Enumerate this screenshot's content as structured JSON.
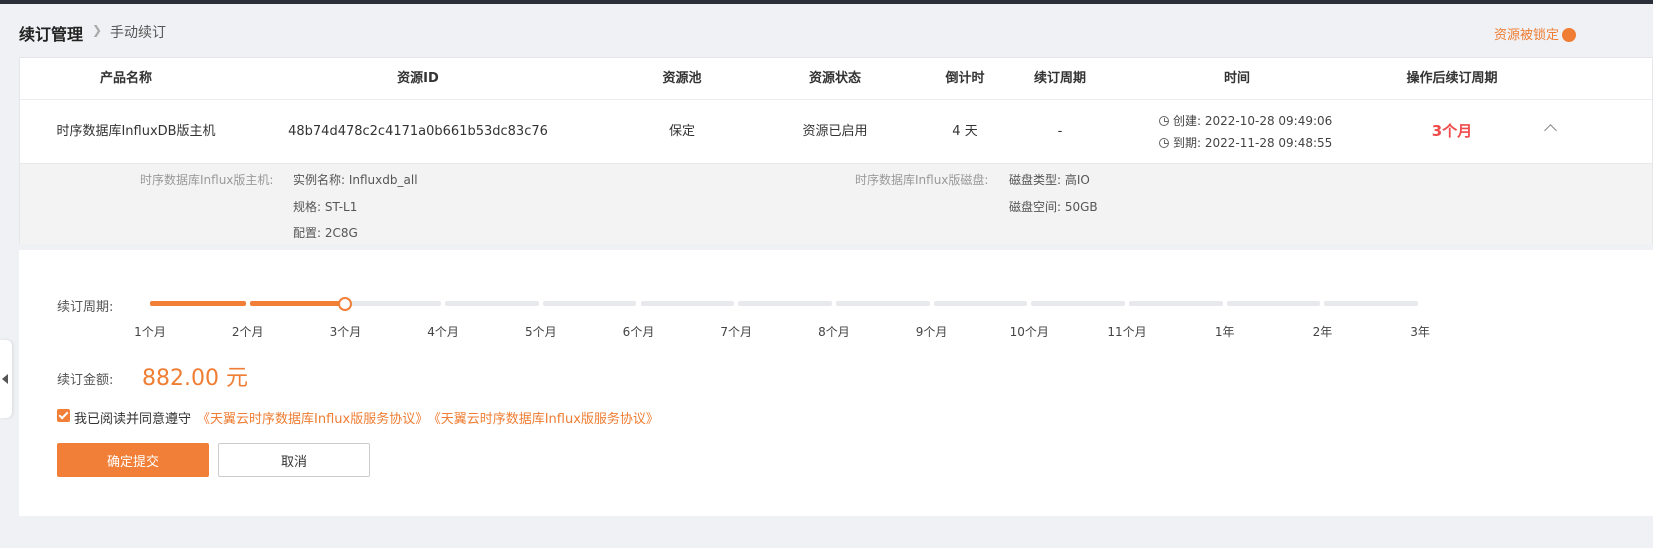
{
  "breadcrumb": {
    "title": "续订管理",
    "current": "手动续订"
  },
  "lock_link": "资源被锁定",
  "table": {
    "headers": [
      "产品名称",
      "资源ID",
      "资源池",
      "资源状态",
      "倒计时",
      "续订周期",
      "时间",
      "操作后续订周期"
    ],
    "row": {
      "product": "时序数据库InfluxDB版主机",
      "resource_id": "48b74d478c2c4171a0b661b53dc83c76",
      "pool": "保定",
      "status": "资源已启用",
      "countdown": "4 天",
      "period": "-",
      "created": "创建: 2022-10-28 09:49:06",
      "expires": "到期: 2022-11-28 09:48:55",
      "new_period": "3个月"
    },
    "detail": {
      "host_label": "时序数据库Influx版主机:",
      "host_fields": [
        "实例名称:  Influxdb_all",
        "规格:  ST-L1",
        "配置:  2C8G"
      ],
      "disk_label": "时序数据库Influx版磁盘:",
      "disk_fields": [
        "磁盘类型:  高IO",
        "磁盘空间:  50GB"
      ]
    }
  },
  "renew": {
    "period_label": "续订周期:",
    "options": [
      "1个月",
      "2个月",
      "3个月",
      "4个月",
      "5个月",
      "6个月",
      "7个月",
      "8个月",
      "9个月",
      "10个月",
      "11个月",
      "1年",
      "2年",
      "3年"
    ],
    "selected_index": 2,
    "amount_label": "续订金额:",
    "amount": "882.00 元",
    "agree_text": "我已阅读并同意遵守",
    "agreements": [
      "《天翼云时序数据库Influx版服务协议》",
      "《天翼云时序数据库Influx版服务协议》"
    ],
    "agree_checked": true,
    "submit": "确定提交",
    "cancel": "取消"
  },
  "colors": {
    "accent": "#f27f37",
    "period_red": "#ef4b4b"
  }
}
